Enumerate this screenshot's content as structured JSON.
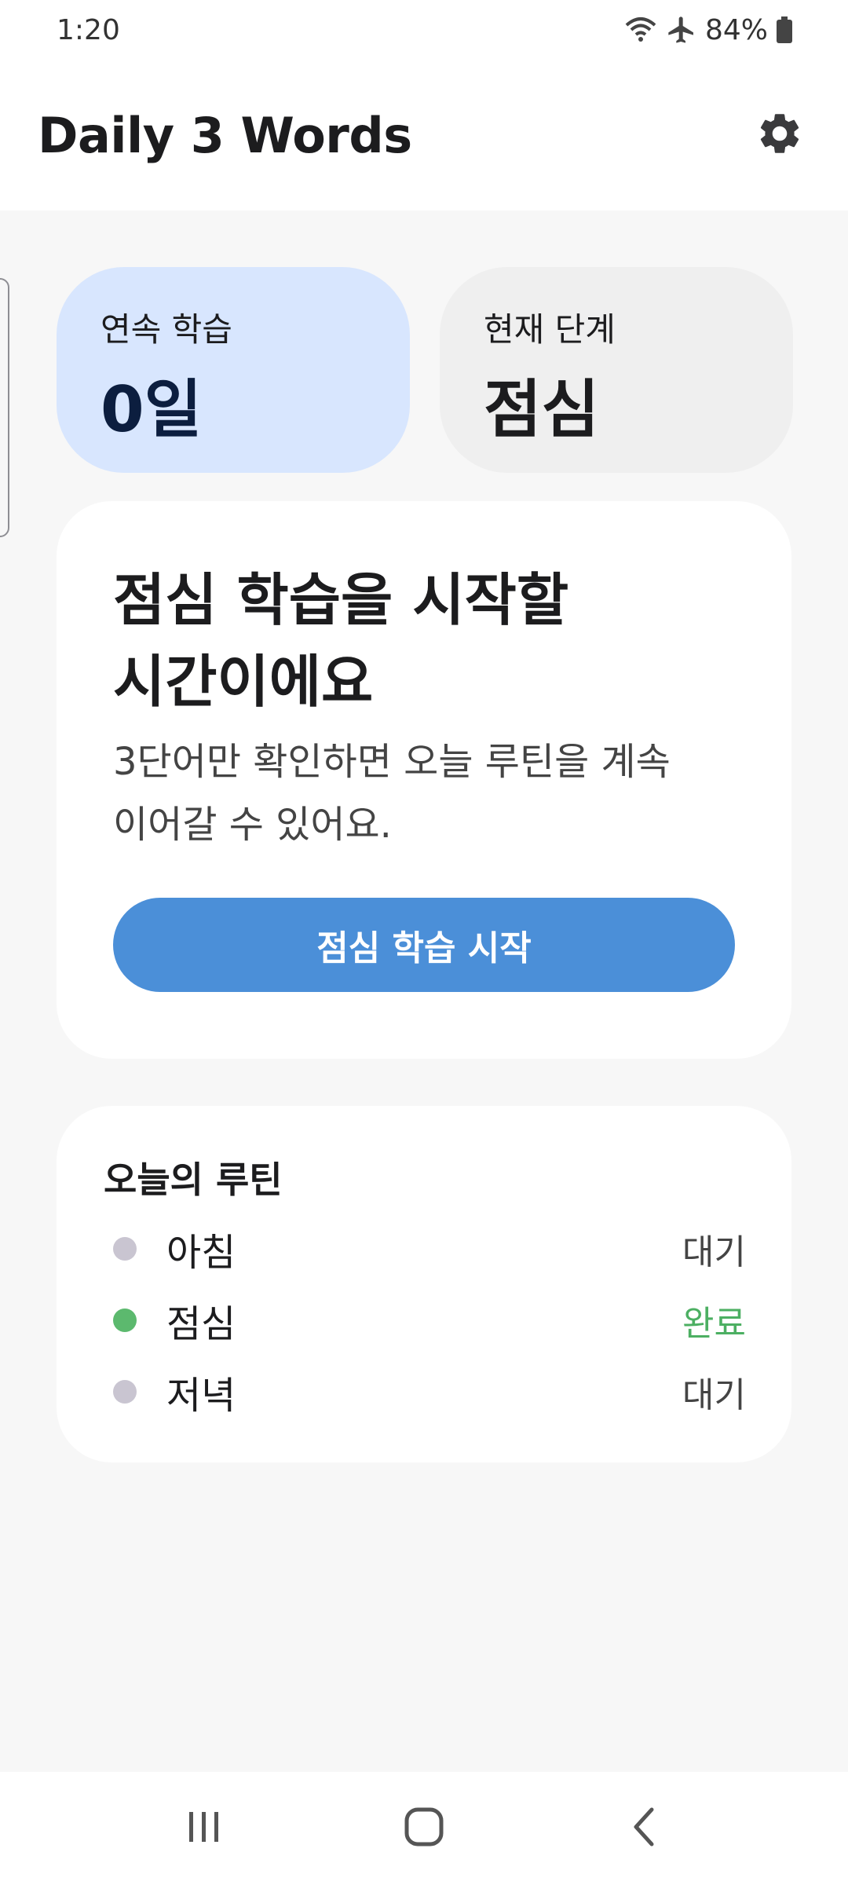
{
  "status_bar": {
    "time": "1:20",
    "battery": "84%",
    "icons": [
      "wifi-icon",
      "airplane-icon",
      "battery-icon"
    ]
  },
  "app_bar": {
    "title": "Daily 3 Words",
    "settings_icon": "gear-icon"
  },
  "stats": {
    "streak": {
      "label": "연속 학습",
      "value": "0일",
      "bg_color": "#d8e6fe"
    },
    "stage": {
      "label": "현재 단계",
      "value": "점심",
      "bg_color": "#efefef"
    }
  },
  "cta": {
    "title_line1": "점심 학습을 시작할",
    "title_line2": "시간이에요",
    "desc_line1": "3단어만 확인하면 오늘 루틴을 계속",
    "desc_line2": "이어갈 수 있어요.",
    "button_label": "점심 학습 시작",
    "button_color": "#4b8fd8"
  },
  "routine": {
    "title": "오늘의 루틴",
    "items": [
      {
        "name": "아침",
        "status": "대기",
        "dot_color": "#c9c5d1",
        "status_color": "#444444"
      },
      {
        "name": "점심",
        "status": "완료",
        "dot_color": "#5cb96e",
        "status_color": "#4caf62"
      },
      {
        "name": "저녁",
        "status": "대기",
        "dot_color": "#c9c5d1",
        "status_color": "#444444"
      }
    ]
  },
  "nav_bar": {
    "icons": [
      "recent-apps-icon",
      "home-icon",
      "back-icon"
    ]
  }
}
